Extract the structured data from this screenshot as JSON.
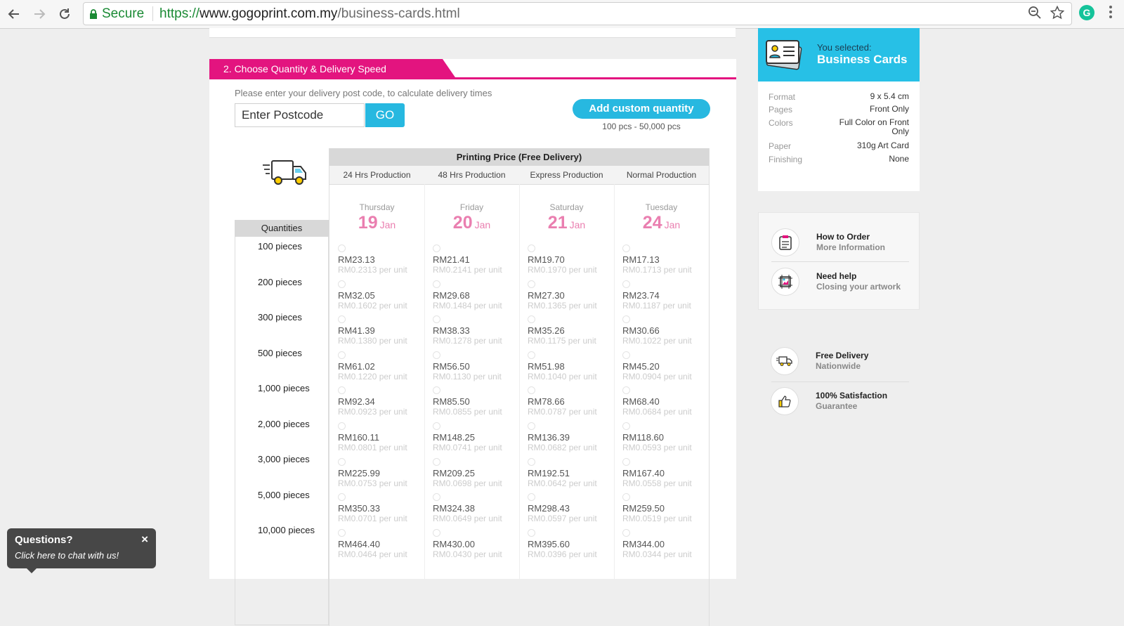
{
  "browser": {
    "secure_label": "Secure",
    "url_protocol": "https://",
    "url_host": "www.gogoprint.com.my",
    "url_path": "/business-cards.html",
    "extension_letter": "G"
  },
  "section": {
    "title": "2. Choose Quantity & Delivery Speed",
    "postcode_label": "Please enter your delivery post code, to calculate delivery times",
    "postcode_placeholder": "Enter Postcode",
    "go_label": "GO",
    "custom_qty_label": "Add custom quantity",
    "custom_qty_range": "100 pcs - 50,000 pcs"
  },
  "table": {
    "title": "Printing Price (Free Delivery)",
    "quantities_header": "Quantities",
    "quantities": [
      "100 pieces",
      "200 pieces",
      "300 pieces",
      "500 pieces",
      "1,000 pieces",
      "2,000 pieces",
      "3,000 pieces",
      "5,000 pieces",
      "10,000 pieces"
    ],
    "columns": [
      {
        "name": "24 Hrs Production",
        "day": "Thursday",
        "date": "19",
        "month": "Jan",
        "prices": [
          "RM23.13",
          "RM32.05",
          "RM41.39",
          "RM61.02",
          "RM92.34",
          "RM160.11",
          "RM225.99",
          "RM350.33",
          "RM464.40"
        ],
        "units": [
          "RM0.2313 per unit",
          "RM0.1602 per unit",
          "RM0.1380 per unit",
          "RM0.1220 per unit",
          "RM0.0923 per unit",
          "RM0.0801 per unit",
          "RM0.0753 per unit",
          "RM0.0701 per unit",
          "RM0.0464 per unit"
        ]
      },
      {
        "name": "48 Hrs Production",
        "day": "Friday",
        "date": "20",
        "month": "Jan",
        "prices": [
          "RM21.41",
          "RM29.68",
          "RM38.33",
          "RM56.50",
          "RM85.50",
          "RM148.25",
          "RM209.25",
          "RM324.38",
          "RM430.00"
        ],
        "units": [
          "RM0.2141 per unit",
          "RM0.1484 per unit",
          "RM0.1278 per unit",
          "RM0.1130 per unit",
          "RM0.0855 per unit",
          "RM0.0741 per unit",
          "RM0.0698 per unit",
          "RM0.0649 per unit",
          "RM0.0430 per unit"
        ]
      },
      {
        "name": "Express Production",
        "day": "Saturday",
        "date": "21",
        "month": "Jan",
        "prices": [
          "RM19.70",
          "RM27.30",
          "RM35.26",
          "RM51.98",
          "RM78.66",
          "RM136.39",
          "RM192.51",
          "RM298.43",
          "RM395.60"
        ],
        "units": [
          "RM0.1970 per unit",
          "RM0.1365 per unit",
          "RM0.1175 per unit",
          "RM0.1040 per unit",
          "RM0.0787 per unit",
          "RM0.0682 per unit",
          "RM0.0642 per unit",
          "RM0.0597 per unit",
          "RM0.0396 per unit"
        ]
      },
      {
        "name": "Normal Production",
        "day": "Tuesday",
        "date": "24",
        "month": "Jan",
        "prices": [
          "RM17.13",
          "RM23.74",
          "RM30.66",
          "RM45.20",
          "RM68.40",
          "RM118.60",
          "RM167.40",
          "RM259.50",
          "RM344.00"
        ],
        "units": [
          "RM0.1713 per unit",
          "RM0.1187 per unit",
          "RM0.1022 per unit",
          "RM0.0904 per unit",
          "RM0.0684 per unit",
          "RM0.0593 per unit",
          "RM0.0558 per unit",
          "RM0.0519 per unit",
          "RM0.0344 per unit"
        ]
      }
    ]
  },
  "sidebar": {
    "selected_label": "You selected:",
    "product_name": "Business Cards",
    "specs": [
      {
        "key": "Format",
        "value": "9 x 5.4 cm"
      },
      {
        "key": "Pages",
        "value": "Front Only"
      },
      {
        "key": "Colors",
        "value": "Full Color on Front Only"
      },
      {
        "key": "Paper",
        "value": "310g Art Card"
      },
      {
        "key": "Finishing",
        "value": "None"
      }
    ],
    "info": [
      {
        "title": "How to Order",
        "subtitle": "More Information",
        "icon": "clipboard-icon"
      },
      {
        "title": "Need help",
        "subtitle": "Closing your artwork",
        "icon": "artwork-icon"
      }
    ],
    "perks": [
      {
        "title": "Free Delivery",
        "subtitle": "Nationwide",
        "icon": "delivery-truck-icon"
      },
      {
        "title": "100% Satisfaction",
        "subtitle": "Guarantee",
        "icon": "thumbs-up-icon"
      }
    ]
  },
  "chat": {
    "title": "Questions?",
    "subtitle": "Click here to chat with us!",
    "close": "×"
  },
  "colors": {
    "brand_pink": "#e3147f",
    "accent_blue": "#27b8e0",
    "date_pink": "#ea7fb0"
  }
}
